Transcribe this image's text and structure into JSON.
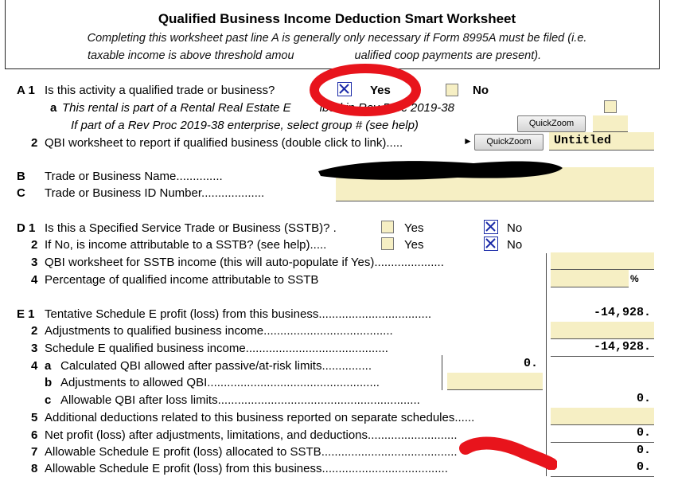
{
  "header": {
    "title": "Qualified Business Income Deduction Smart Worksheet",
    "subtitle_line1": "Completing this worksheet past line A is generally only necessary if Form 8995A must be filed (i.e.",
    "subtitle_line2": "taxable income is above threshold amou",
    "subtitle_line2_end": "ualified coop payments are present)."
  },
  "lineA": {
    "num": "A 1",
    "q1": "Is this activity a qualified trade or business?",
    "yes": "Yes",
    "no": "No",
    "a_num": "a",
    "a_text": "This rental is part of a Rental Real Estate E",
    "a_text_end": "ibed in Rev Proc 2019-38",
    "sub_text": "If part of a Rev Proc 2019-38 enterprise, select group # (see help)",
    "quickzoom1": "QuickZoom",
    "l2_num": "2",
    "l2_text": "QBI worksheet to report if qualified business (double click to link)",
    "quickzoom2": "QuickZoom",
    "l2_value": "Untitled"
  },
  "lineB": {
    "num": "B",
    "text": "Trade or Business Name"
  },
  "lineC": {
    "num": "C",
    "text": "Trade or Business ID Number"
  },
  "lineD": {
    "d1_num": "D 1",
    "d1_text": "Is this a Specified Service Trade or Business (SSTB)?",
    "yes": "Yes",
    "no": "No",
    "d2_num": "2",
    "d2_text": "If No, is income attributable to a SSTB? (see help)",
    "d3_num": "3",
    "d3_text": "QBI worksheet for SSTB income (this will auto-populate if Yes)",
    "d4_num": "4",
    "d4_text": "Percentage of qualified income attributable to SSTB",
    "pct": "%"
  },
  "lineE": {
    "e1_num": "E 1",
    "e1_text": "Tentative Schedule E profit (loss) from this business",
    "e1_val": "-14,928.",
    "e2_num": "2",
    "e2_text": "Adjustments to qualified business income",
    "e3_num": "3",
    "e3_text": "Schedule E qualified business income",
    "e3_val": "-14,928.",
    "e4_num": "4",
    "e4a_sub": "a",
    "e4a_text": "Calculated QBI allowed after passive/at-risk limits",
    "e4a_val": "0.",
    "e4b_sub": "b",
    "e4b_text": "Adjustments to allowed QBI",
    "e4c_sub": "c",
    "e4c_text": "Allowable QBI after loss limits",
    "e4c_val": "0.",
    "e5_num": "5",
    "e5_text": "Additional deductions related to this business reported on separate schedules",
    "e6_num": "6",
    "e6_text": "Net profit (loss) after adjustments, limitations, and deductions",
    "e6_val": "0.",
    "e7_num": "7",
    "e7_text": "Allowable Schedule E profit (loss) allocated to SSTB",
    "e7_val": "0.",
    "e8_num": "8",
    "e8_text": "Allowable Schedule E profit (loss) from this business",
    "e8_val": "0."
  },
  "colors": {
    "field_bg": "#f6efc4",
    "check_blue": "#1a2aa8",
    "annotation_red": "#e8141c",
    "redaction": "#000000"
  }
}
